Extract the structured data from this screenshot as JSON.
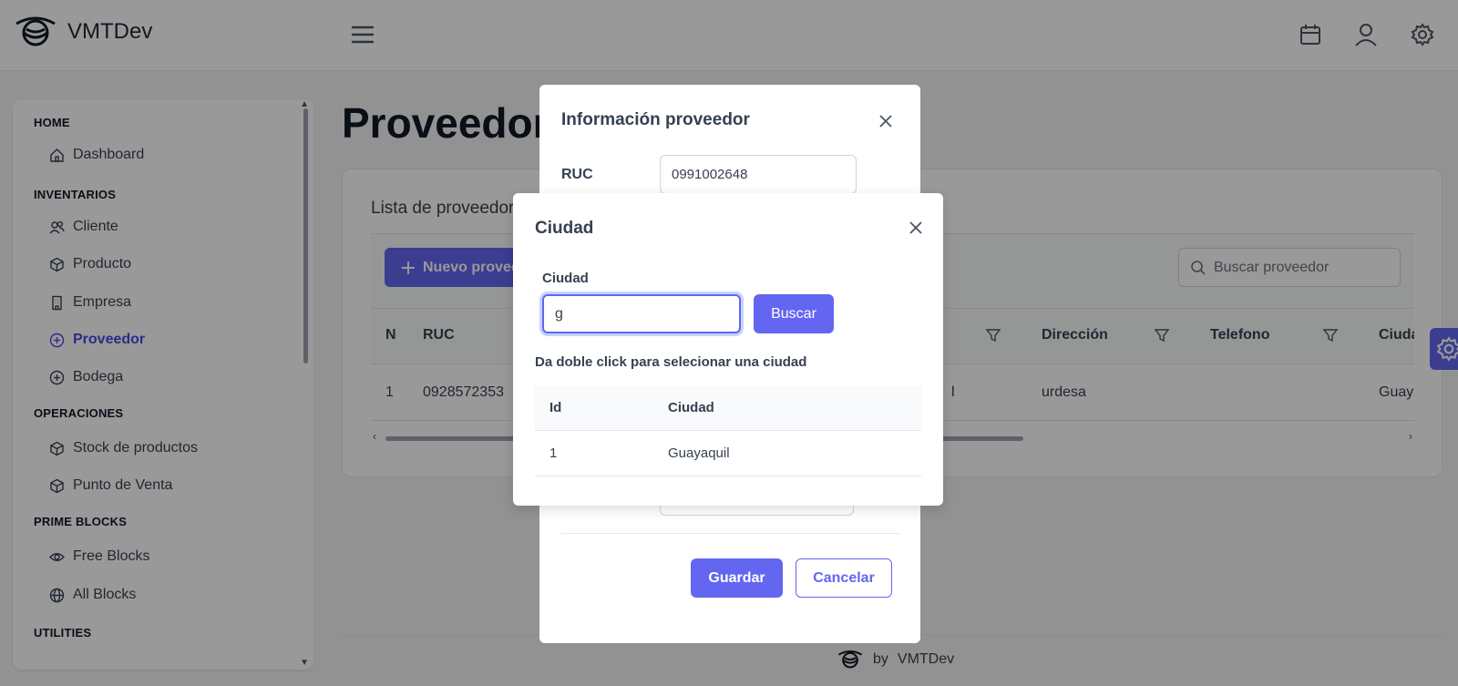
{
  "app": {
    "name": "VMTDev"
  },
  "sidebar": {
    "sections": [
      {
        "title": "HOME",
        "items": [
          {
            "label": "Dashboard",
            "icon": "home-icon"
          }
        ]
      },
      {
        "title": "INVENTARIOS",
        "items": [
          {
            "label": "Cliente",
            "icon": "users-icon"
          },
          {
            "label": "Producto",
            "icon": "box-icon"
          },
          {
            "label": "Empresa",
            "icon": "building-icon"
          },
          {
            "label": "Proveedor",
            "icon": "plus-circle-icon",
            "active": true
          },
          {
            "label": "Bodega",
            "icon": "plus-circle-icon"
          }
        ]
      },
      {
        "title": "OPERACIONES",
        "items": [
          {
            "label": "Stock de productos",
            "icon": "box-icon"
          },
          {
            "label": "Punto de Venta",
            "icon": "box-icon"
          }
        ]
      },
      {
        "title": "PRIME BLOCKS",
        "items": [
          {
            "label": "Free Blocks",
            "icon": "eye-icon"
          },
          {
            "label": "All Blocks",
            "icon": "globe-icon"
          }
        ]
      },
      {
        "title": "UTILITIES",
        "items": []
      }
    ]
  },
  "main": {
    "title": "Proveedor",
    "card_title": "Lista de proveedores",
    "new_button": "Nuevo proveedor",
    "search_placeholder": "Buscar proveedor",
    "columns": [
      "N",
      "RUC",
      "Dirección",
      "Telefono",
      "Ciudad"
    ],
    "rows": [
      {
        "n": "1",
        "ruc": "0928572353",
        "partial": "l",
        "direccion": "urdesa",
        "telefono": "",
        "ciudad": "Guayaquil"
      }
    ]
  },
  "footer": {
    "by": "by",
    "brand": "VMTDev"
  },
  "dialog_proveedor": {
    "title": "Información proveedor",
    "ruc_label": "RUC",
    "ruc_value": "0991002648",
    "save_label": "Guardar",
    "cancel_label": "Cancelar"
  },
  "dialog_ciudad": {
    "title": "Ciudad",
    "field_label": "Ciudad",
    "field_value": "g",
    "search_label": "Buscar",
    "hint": "Da doble click para selecionar una ciudad",
    "columns": [
      "Id",
      "Ciudad"
    ],
    "rows": [
      {
        "id": "1",
        "ciudad": "Guayaquil"
      }
    ]
  },
  "colors": {
    "accent": "#6366f1",
    "overlay": "rgba(0,0,0,0.4)"
  }
}
